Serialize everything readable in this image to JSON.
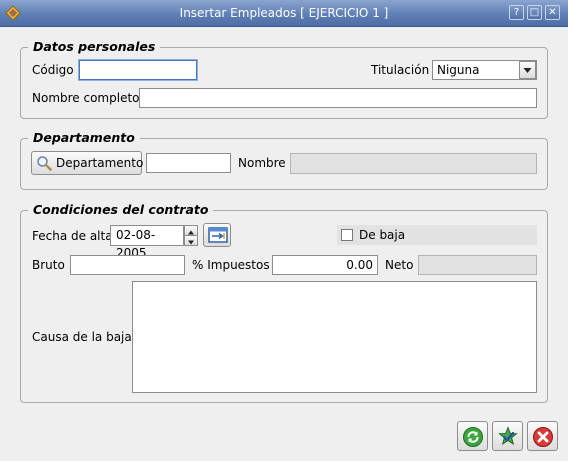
{
  "window": {
    "title": "Insertar Empleados [ EJERCICIO 1 ]",
    "help": "?",
    "maximize": "□",
    "close": "✕"
  },
  "personal": {
    "legend": "Datos personales",
    "codigo_label": "Código",
    "codigo_value": "",
    "titulacion_label": "Titulación",
    "titulacion_value": "Niguna",
    "nombre_label": "Nombre completo",
    "nombre_value": ""
  },
  "departamento": {
    "legend": "Departamento",
    "button_label": "Departamento",
    "code_value": "",
    "nombre_label": "Nombre",
    "nombre_value": ""
  },
  "contrato": {
    "legend": "Condiciones del contrato",
    "fecha_label": "Fecha de alta",
    "fecha_value": "02-08-2005",
    "debaja_label": "De baja",
    "debaja_checked": false,
    "bruto_label": "Bruto",
    "bruto_value": "",
    "impuestos_label": "% Impuestos",
    "impuestos_value": "0.00",
    "neto_label": "Neto",
    "neto_value": "",
    "causa_label": "Causa de la baja",
    "causa_value": ""
  },
  "icons": {
    "app": "app-icon",
    "search": "search-icon",
    "calendar": "calendar-icon",
    "refresh": "refresh-icon",
    "accept": "accept-icon",
    "cancel": "cancel-icon"
  },
  "colors": {
    "titlebar": "#5f7fb5",
    "focus": "#4c74b8",
    "cancel": "#d32f2f",
    "accept": "#2e8b2e"
  }
}
